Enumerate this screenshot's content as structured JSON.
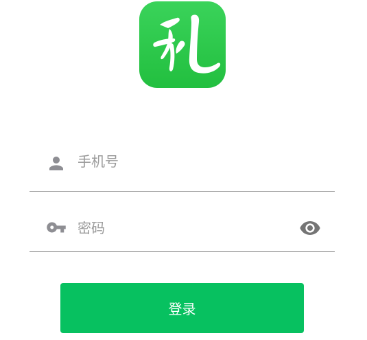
{
  "logo": {
    "icon": "li-calligraphy-logo",
    "glyph": "礼",
    "background": "#2cc74a"
  },
  "phone_field": {
    "icon": "person-icon",
    "placeholder": "手机号",
    "value": ""
  },
  "password_field": {
    "icon": "key-icon",
    "placeholder": "密码",
    "value": "",
    "toggle_icon": "eye-icon"
  },
  "login_button": {
    "label": "登录",
    "color": "#07c160"
  }
}
